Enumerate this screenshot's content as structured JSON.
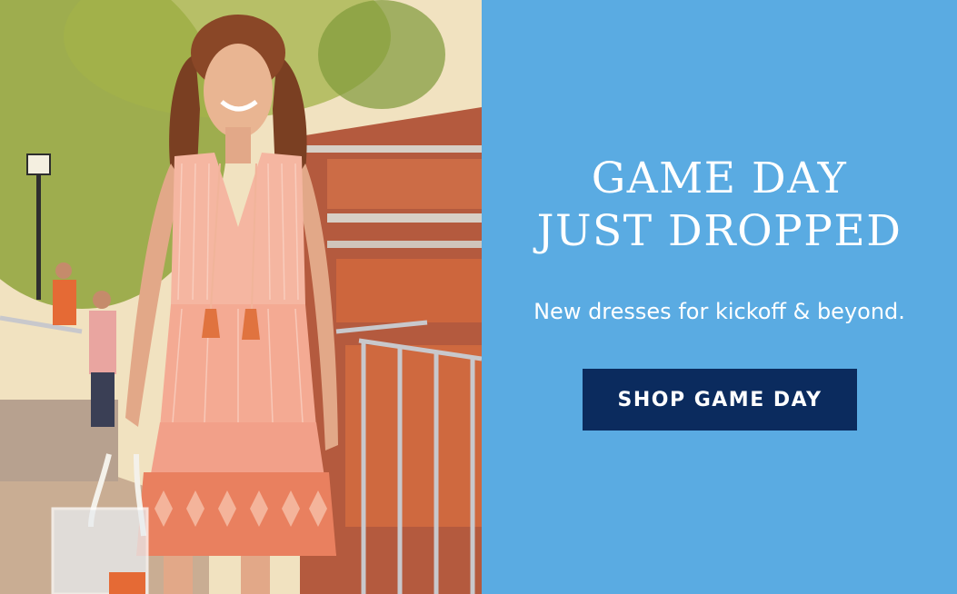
{
  "promo": {
    "headline_line1": "GAME DAY",
    "headline_line2": "JUST DROPPED",
    "subhead": "New dresses for kickoff & beyond.",
    "cta_label": "SHOP GAME DAY"
  },
  "photo": {
    "subject": "model-in-striped-tiered-dress-at-stadium"
  },
  "colors": {
    "panel_blue": "#5aabe2",
    "button_navy": "#0b2b5e",
    "text_white": "#ffffff",
    "dress_peach": "#f2a58c",
    "stadium_orange": "#d9623b"
  }
}
